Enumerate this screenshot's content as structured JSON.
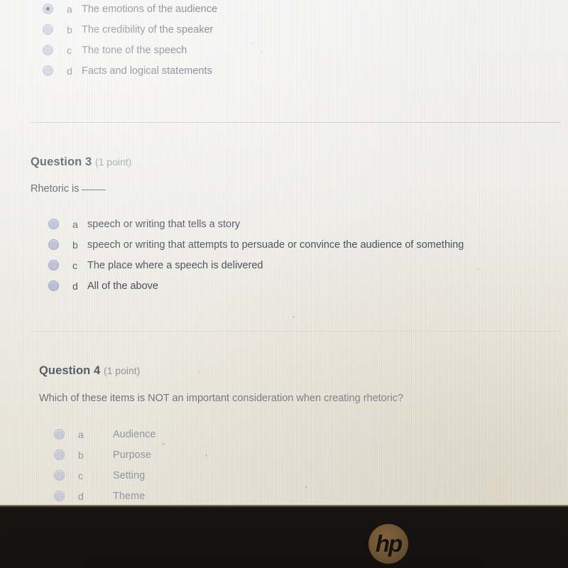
{
  "device": {
    "brand_logo_label": "hp",
    "bezel_name": "laptop-bottom-bezel"
  },
  "quiz": {
    "points_label": "(1 point)",
    "questions": [
      {
        "id": "question-2-partial",
        "heading": "",
        "points": "",
        "stem": "",
        "options": [
          {
            "letter": "a",
            "text": "The emotions of the audience",
            "selected": true
          },
          {
            "letter": "b",
            "text": "The credibility of the speaker",
            "selected": false
          },
          {
            "letter": "c",
            "text": "The tone of the speech",
            "selected": false
          },
          {
            "letter": "d",
            "text": "Facts and logical statements",
            "selected": false
          }
        ]
      },
      {
        "id": "question-3",
        "heading": "Question 3",
        "points": "(1 point)",
        "stem": "Rhetoric is",
        "stem_has_blank": true,
        "options": [
          {
            "letter": "a",
            "text": "speech or writing that tells a story",
            "selected": false
          },
          {
            "letter": "b",
            "text": "speech or writing that attempts to persuade or convince the audience of something",
            "selected": false
          },
          {
            "letter": "c",
            "text": "The place where a speech is delivered",
            "selected": false
          },
          {
            "letter": "d",
            "text": "All of the above",
            "selected": false
          }
        ]
      },
      {
        "id": "question-4",
        "heading": "Question 4",
        "points": "(1 point)",
        "stem": "Which of these items is NOT an important consideration when creating rhetoric?",
        "stem_has_blank": false,
        "options": [
          {
            "letter": "a",
            "text": "Audience",
            "selected": false
          },
          {
            "letter": "b",
            "text": "Purpose",
            "selected": false
          },
          {
            "letter": "c",
            "text": "Setting",
            "selected": false
          },
          {
            "letter": "d",
            "text": "Theme",
            "selected": false
          }
        ]
      }
    ]
  },
  "colors": {
    "page_background": "#f1f0ec",
    "text_primary": "#3f4854",
    "text_heading": "#323a45",
    "text_muted": "#8b929c",
    "radio_fill": "#b9bdd4",
    "radio_dot": "#3b3f57",
    "separator": "#b8bcc4",
    "bezel": "#141210",
    "hp_logo_bronze": "#7a5c39"
  }
}
